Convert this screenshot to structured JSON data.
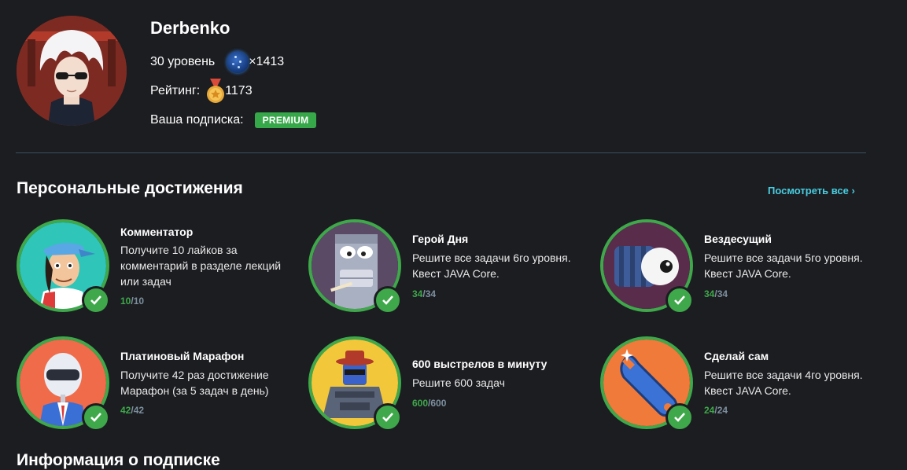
{
  "profile": {
    "name": "Derbenko",
    "level": "30 уровень",
    "dark_matter": "×1413",
    "rating_label": "Рейтинг:",
    "rating_value": "1173",
    "subscription_label": "Ваша подписка:",
    "subscription_badge": "PREMIUM"
  },
  "achievements_section": {
    "title": "Персональные достижения",
    "see_all": "Посмотреть все ›"
  },
  "achievements": [
    {
      "title": "Комментатор",
      "description": "Получите 10 лайков за комментарий в разделе лекций или задач",
      "done": "10",
      "total": "/10",
      "icon": "commentator-icon"
    },
    {
      "title": "Герой Дня",
      "description": "Решите все задачи 6го уровня. Квест JAVA Core.",
      "done": "34",
      "total": "/34",
      "icon": "hero-of-day-icon"
    },
    {
      "title": "Вездесущий",
      "description": "Решите все задачи 5го уровня. Квест JAVA Core.",
      "done": "34",
      "total": "/34",
      "icon": "omnipresent-icon"
    },
    {
      "title": "Платиновый Марафон",
      "description": "Получите 42 раз достижение Марафон (за 5 задач в день)",
      "done": "42",
      "total": "/42",
      "icon": "platinum-marathon-icon"
    },
    {
      "title": "600 выстрелов в минуту",
      "description": "Решите 600 задач",
      "done": "600",
      "total": "/600",
      "icon": "600-shots-icon"
    },
    {
      "title": "Сделай сам",
      "description": "Решите все задачи 4го уровня. Квест JAVA Core.",
      "done": "24",
      "total": "/24",
      "icon": "diy-wrench-icon"
    }
  ],
  "bottom_section": {
    "title": "Информация о подписке"
  },
  "colors": {
    "background": "#1c1d21",
    "accent_green": "#3ea84a",
    "link": "#48cde0"
  }
}
